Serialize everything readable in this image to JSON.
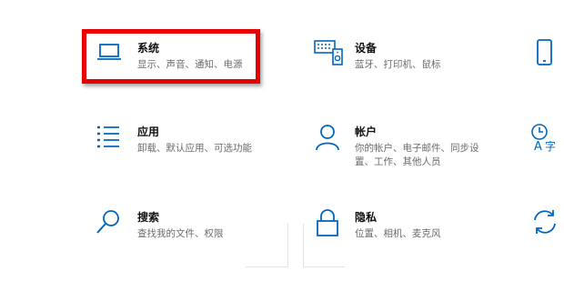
{
  "settings": {
    "tiles": [
      {
        "title": "系统",
        "desc": "显示、声音、通知、电源",
        "icon": "laptop-icon"
      },
      {
        "title": "设备",
        "desc": "蓝牙、打印机、鼠标",
        "icon": "keyboard-speaker-icon"
      },
      {
        "title": "",
        "desc": "",
        "icon": "phone-icon"
      },
      {
        "title": "应用",
        "desc": "卸载、默认应用、可选功能",
        "icon": "apps-list-icon"
      },
      {
        "title": "帐户",
        "desc_line1": "你的帐户、电子邮件、同步设",
        "desc_line2": "置、工作、其他人员",
        "icon": "person-icon"
      },
      {
        "title": "",
        "desc": "",
        "icon": "time-language-icon"
      },
      {
        "title": "搜索",
        "desc": "查找我的文件、权限",
        "icon": "search-icon"
      },
      {
        "title": "隐私",
        "desc": "位置、相机、麦克风",
        "icon": "lock-icon"
      },
      {
        "title": "",
        "desc": "",
        "icon": "update-sync-icon"
      }
    ],
    "accent_color": "#0067c0",
    "highlight_color": "#e60000"
  }
}
